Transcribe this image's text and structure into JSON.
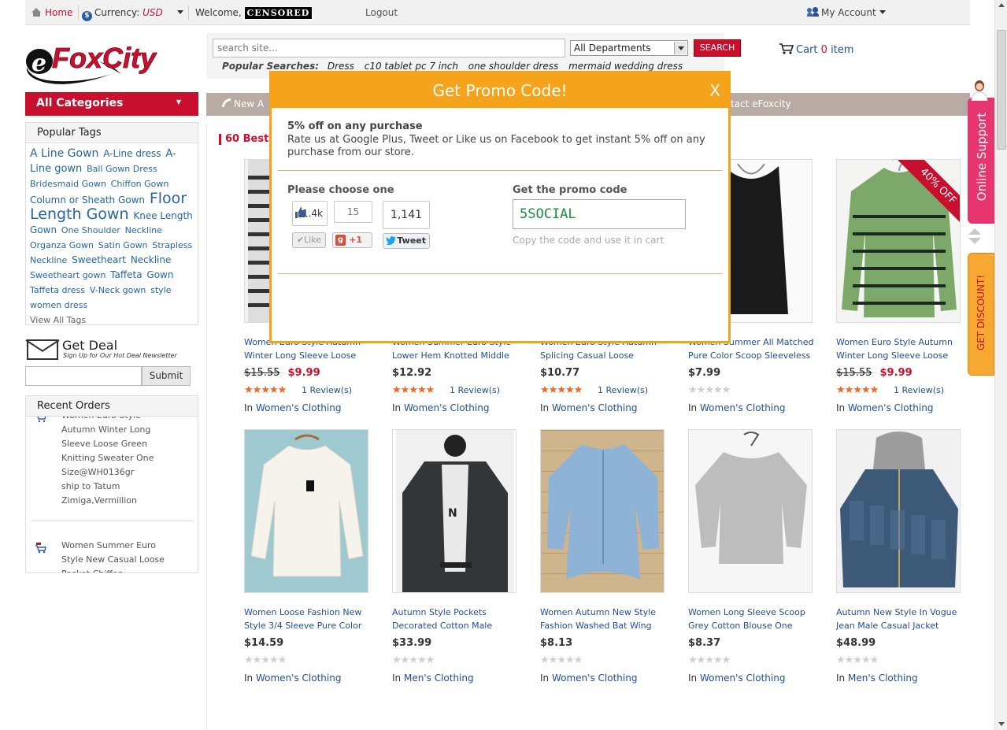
{
  "topbar": {
    "home": "Home",
    "currency_label": "Currency:",
    "currency_value": "USD",
    "welcome": "Welcome,",
    "censored": "CENSORED",
    "logout": "Logout",
    "my_account": "My Account"
  },
  "logo": {
    "text": "FoxCity",
    "prefix": "e"
  },
  "search": {
    "placeholder": "search site...",
    "department": "All Departments",
    "button": "SEARCH",
    "popular_label": "Popular Searches:",
    "popular": [
      "Dress",
      "c10 tablet pc 7 inch",
      "one shoulder dress",
      "mermaid wedding dress"
    ]
  },
  "cart": {
    "prefix": "Cart",
    "count": "0",
    "suffix": "item"
  },
  "sidebar": {
    "all_categories": "All Categories",
    "popular_tags_title": "Popular Tags",
    "tags": [
      {
        "t": "A Line Gown",
        "s": 14
      },
      {
        "t": "A-Line dress",
        "s": 12
      },
      {
        "t": "A-Line gown",
        "s": 13
      },
      {
        "t": "Ball Gown Dress",
        "s": 11
      },
      {
        "t": "Bridesmaid Gown",
        "s": 11
      },
      {
        "t": "Chiffon Gown",
        "s": 11
      },
      {
        "t": "Column or Sheath Gown",
        "s": 12
      },
      {
        "t": "Floor Length Gown",
        "s": 19
      },
      {
        "t": "Knee Length Gown",
        "s": 12
      },
      {
        "t": "One Shoulder",
        "s": 11
      },
      {
        "t": "Neckline",
        "s": 11
      },
      {
        "t": "Organza Gown",
        "s": 11
      },
      {
        "t": "Satin Gown",
        "s": 11
      },
      {
        "t": "Strapless Neckline",
        "s": 11
      },
      {
        "t": "Sweetheart",
        "s": 12
      },
      {
        "t": "Neckline",
        "s": 12
      },
      {
        "t": "Sweetheart gown",
        "s": 11
      },
      {
        "t": "Taffeta",
        "s": 12
      },
      {
        "t": "Gown",
        "s": 12
      },
      {
        "t": "Taffeta dress",
        "s": 11
      },
      {
        "t": "V-Neck gown",
        "s": 11
      },
      {
        "t": "style women dress",
        "s": 11
      }
    ],
    "view_all_tags": "View All Tags",
    "get_deal_title": "Get Deal",
    "get_deal_sub": "Sign Up for Our Hot Deal Newsletter",
    "submit": "Submit",
    "recent_orders_title": "Recent Orders",
    "orders": [
      [
        "Women Euro Style",
        "Autumn Winter Long",
        "Sleeve Loose Green",
        "Knitting Sweater One",
        "Size@WH0136gr",
        "ship to Tatum",
        "Zimiga,Vermillion"
      ],
      [
        "Women Summer Euro",
        "Style New Casual Loose",
        "Pocket Chiffon"
      ]
    ]
  },
  "nav": {
    "left": "New A",
    "right": "tact eFoxcity"
  },
  "main": {
    "section_title": "60 Best",
    "products": [
      {
        "name": "Women Euro Style Autumn Winter Long Sleeve Loose",
        "old": "$15.55",
        "price": "$9.99",
        "rating": 5,
        "reviews": "1 Review(s)",
        "in": "In",
        "category": "Women's Clothing"
      },
      {
        "name": "Women Summer Euro Style Lower Hem Knotted Middle",
        "old": "",
        "price": "$12.92",
        "rating": 5,
        "reviews": "1 Review(s)",
        "in": "In",
        "category": "Women's Clothing"
      },
      {
        "name": "Women Euro Style Autumn Splicing Casual Loose",
        "old": "",
        "price": "$10.77",
        "rating": 5,
        "reviews": "1 Review(s)",
        "in": "In",
        "category": "Women's Clothing"
      },
      {
        "name": "Women Summer All Matched Pure Color Scoop Sleeveless Slim",
        "old": "",
        "price": "$7.99",
        "rating": 0,
        "reviews": "",
        "in": "In",
        "category": "Women's Clothing"
      },
      {
        "name": "Women Euro Style Autumn Winter Long Sleeve Loose",
        "old": "$15.55",
        "price": "$9.99",
        "rating": 4.5,
        "reviews": "1 Review(s)",
        "in": "In",
        "category": "Women's Clothing",
        "badge": "40% OFF"
      },
      {
        "name": "Women Loose Fashion New Style 3/4 Sleeve Pure Color",
        "old": "",
        "price": "$14.59",
        "rating": 0,
        "reviews": "",
        "in": "In",
        "category": "Women's Clothing"
      },
      {
        "name": "Autumn Style Pockets Decorated Cotton Male",
        "old": "",
        "price": "$33.99",
        "rating": 0,
        "reviews": "",
        "in": "In",
        "category": "Men's Clothing"
      },
      {
        "name": "Women Autumn New Style Fashion Washed Bat Wing",
        "old": "",
        "price": "$8.13",
        "rating": 0,
        "reviews": "",
        "in": "In",
        "category": "Women's Clothing"
      },
      {
        "name": "Women Long Sleeve Scoop Grey Cotton Blouse One",
        "old": "",
        "price": "$8.37",
        "rating": 0,
        "reviews": "",
        "in": "In",
        "category": "Women's Clothing"
      },
      {
        "name": "Autumn New Style In Vogue Jean Male Casual Jacket",
        "old": "",
        "price": "$48.99",
        "rating": 0,
        "reviews": "",
        "in": "In",
        "category": "Men's Clothing"
      }
    ]
  },
  "modal": {
    "title": "Get Promo Code!",
    "close": "X",
    "offer_title": "5% off on any purchase",
    "offer_text": "Rate us at Google Plus, Tweet or Like us on Facebook to get instant 5% off on any purchase from our store.",
    "choose_label": "Please choose one",
    "like_count": "1.4k",
    "like_button": "Like",
    "gplus_count": "15",
    "gplus_button": "+1",
    "tweet_count": "1,141",
    "tweet_button": "Tweet",
    "get_code_label": "Get the promo code",
    "code": "5SOCIAL",
    "code_hint": "Copy the code and use it in cart"
  },
  "side": {
    "online_support": "Online Support",
    "get_discount": "GET DISCOUNT!"
  },
  "colors": {
    "brand_red": "#c8102e",
    "modal_orange": "#f5a31a",
    "support_pink": "#e6356f",
    "link_blue": "#1f4e99"
  }
}
